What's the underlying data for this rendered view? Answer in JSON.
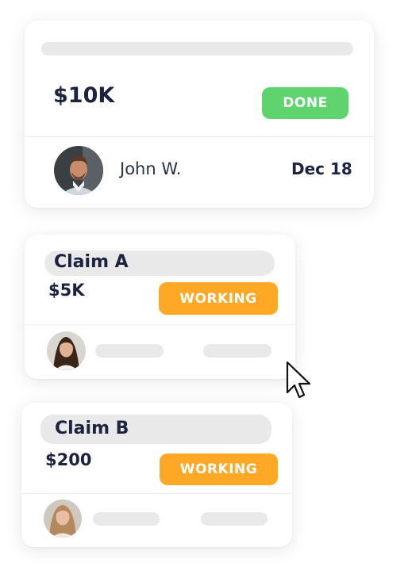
{
  "colors": {
    "navy": "#1c2341",
    "done_green": "#5fd36d",
    "working_orange": "#ffa826",
    "placeholder_gray": "#e9e9e9"
  },
  "card_main": {
    "amount": "$10K",
    "status": "DONE",
    "person_name": "John W.",
    "date": "Dec 18",
    "avatar": "man-portrait"
  },
  "card_a": {
    "title": "Claim A",
    "amount": "$5K",
    "status": "WORKING",
    "avatar": "woman-portrait-dark-hair"
  },
  "card_b": {
    "title": "Claim B",
    "amount": "$200",
    "status": "WORKING",
    "avatar": "woman-portrait-blonde"
  },
  "cursor": "arrow-cursor"
}
